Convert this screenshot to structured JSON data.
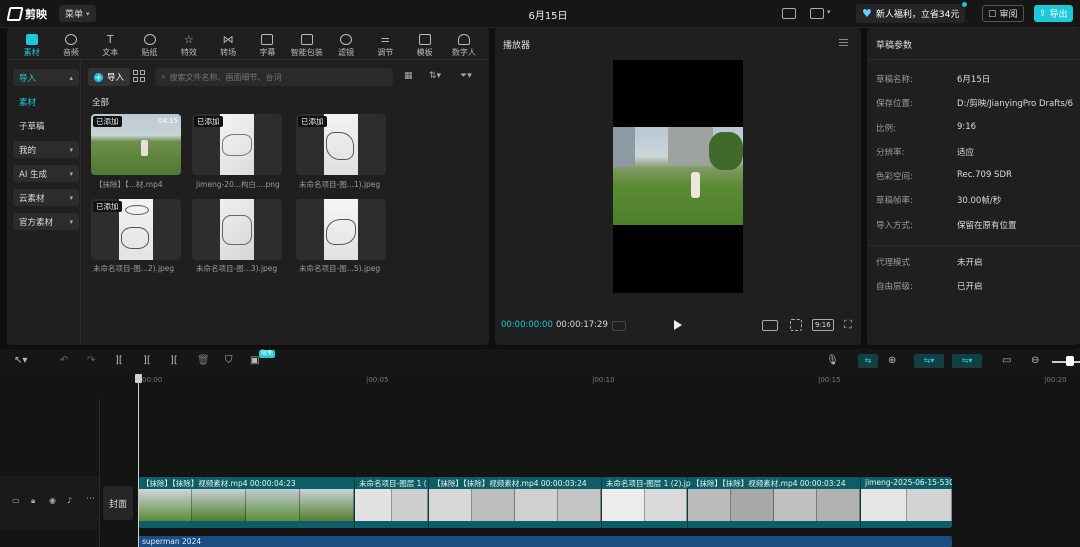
{
  "app": {
    "name": "剪映",
    "menu_label": "菜单",
    "title": "6月15日"
  },
  "topbar": {
    "promo_label": "新人福利，立省34元",
    "review_label": "审阅",
    "export_label": "导出"
  },
  "tabs": [
    {
      "label": "素材",
      "icon": "media-icon"
    },
    {
      "label": "音频",
      "icon": "audio-icon"
    },
    {
      "label": "文本",
      "icon": "text-icon"
    },
    {
      "label": "贴纸",
      "icon": "sticker-icon"
    },
    {
      "label": "特效",
      "icon": "effects-icon"
    },
    {
      "label": "转场",
      "icon": "transition-icon"
    },
    {
      "label": "字幕",
      "icon": "subtitle-icon"
    },
    {
      "label": "智能包装",
      "icon": "smart-pack-icon"
    },
    {
      "label": "滤镜",
      "icon": "filter-icon"
    },
    {
      "label": "调节",
      "icon": "adjust-icon"
    },
    {
      "label": "模板",
      "icon": "template-icon"
    },
    {
      "label": "数字人",
      "icon": "avatar-icon"
    }
  ],
  "sidebar": {
    "items": [
      {
        "label": "导入"
      },
      {
        "label": "素材"
      },
      {
        "label": "子草稿"
      },
      {
        "label": "我的"
      },
      {
        "label": "AI 生成"
      },
      {
        "label": "云素材"
      },
      {
        "label": "官方素材"
      }
    ]
  },
  "media": {
    "import_label": "导入",
    "search_placeholder": "搜索文件名称、画面细节、台词",
    "section_label": "全部",
    "items": [
      {
        "label": "【抹除】【...材.mp4",
        "badge": "已添加",
        "duration": "04:15"
      },
      {
        "label": "jimeng-20...构白....png",
        "badge": "已添加",
        "duration": ""
      },
      {
        "label": "未命名项目-图...1).jpeg",
        "badge": "已添加",
        "duration": ""
      },
      {
        "label": "未命名项目-图...2).jpeg",
        "badge": "已添加",
        "duration": ""
      },
      {
        "label": "未命名项目-图...3).jpeg",
        "badge": "",
        "duration": ""
      },
      {
        "label": "未命名项目-图...5).jpeg",
        "badge": "",
        "duration": ""
      }
    ]
  },
  "player": {
    "title": "播放器",
    "current_time": "00:00:00:00",
    "total_time": "00:00:17:29",
    "ratio_label": "9:16"
  },
  "params": {
    "title": "草稿参数",
    "rows": [
      {
        "key": "草稿名称:",
        "value": "6月15日"
      },
      {
        "key": "保存位置:",
        "value": "D:/剪映/JianyingPro Drafts/6"
      },
      {
        "key": "比例:",
        "value": "9:16"
      },
      {
        "key": "分辨率:",
        "value": "适应"
      },
      {
        "key": "色彩空间:",
        "value": "Rec.709 SDR"
      },
      {
        "key": "草稿帧率:",
        "value": "30.00帧/秒"
      },
      {
        "key": "导入方式:",
        "value": "保留在原有位置"
      },
      {
        "key": "代理模式",
        "value": "未开启"
      },
      {
        "key": "自由层级:",
        "value": "已开启"
      }
    ]
  },
  "timeline": {
    "beta_label": "限免",
    "ruler": [
      "00:00",
      "|00:05",
      "|00:10",
      "|00:15",
      "|00:20"
    ],
    "cover_label": "封面",
    "clips": [
      {
        "title": "【抹除】【抹除】视频素材.mp4   00:00:04:23"
      },
      {
        "title": "未命名项目-图层 1 ("
      },
      {
        "title": "【抹除】【抹除】视频素材.mp4   00:00:03:24"
      },
      {
        "title": "未命名项目-图层 1 (2).jp"
      },
      {
        "title": "【抹除】【抹除】视频素材.mp4   00:00:03:24"
      },
      {
        "title": "jimeng-2025-06-15-530"
      }
    ],
    "audio_label": "superman 2024"
  },
  "colors": {
    "accent": "#1fc8d6",
    "video_track": "#0d5d66",
    "audio_track": "#1b4d80"
  }
}
